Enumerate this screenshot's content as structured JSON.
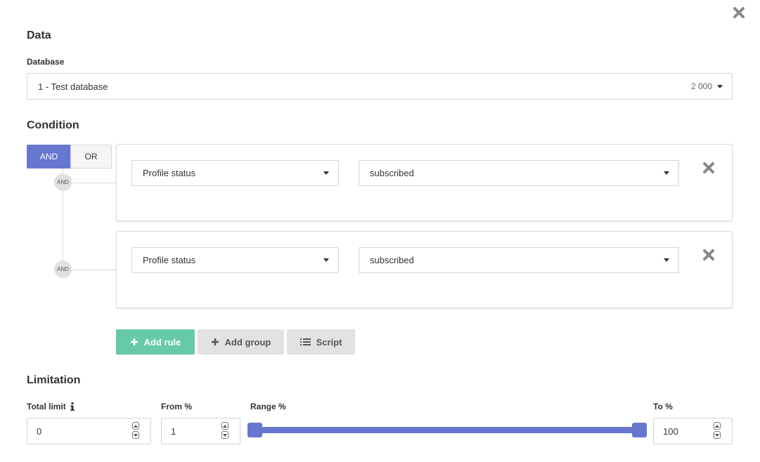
{
  "data_section": {
    "title": "Data",
    "database_label": "Database",
    "database_value": "1 - Test database",
    "database_count": "2 000"
  },
  "condition": {
    "title": "Condition",
    "and_label": "AND",
    "or_label": "OR",
    "badge_label": "AND",
    "rules": [
      {
        "field": "Profile status",
        "value": "subscribed"
      },
      {
        "field": "Profile status",
        "value": "subscribed"
      }
    ],
    "add_rule_label": "Add rule",
    "add_group_label": "Add group",
    "script_label": "Script"
  },
  "limitation": {
    "title": "Limitation",
    "total_limit_label": "Total limit",
    "total_limit_value": "0",
    "from_label": "From %",
    "from_value": "1",
    "range_label": "Range %",
    "to_label": "To %",
    "to_value": "100",
    "range_from_fraction": 0.01,
    "range_to_fraction": 1.0
  },
  "colors": {
    "accent": "#6777cf",
    "add_rule_bg": "#66c9aa",
    "secondary_bg": "#e2e2e2",
    "close_icon": "#888888"
  }
}
